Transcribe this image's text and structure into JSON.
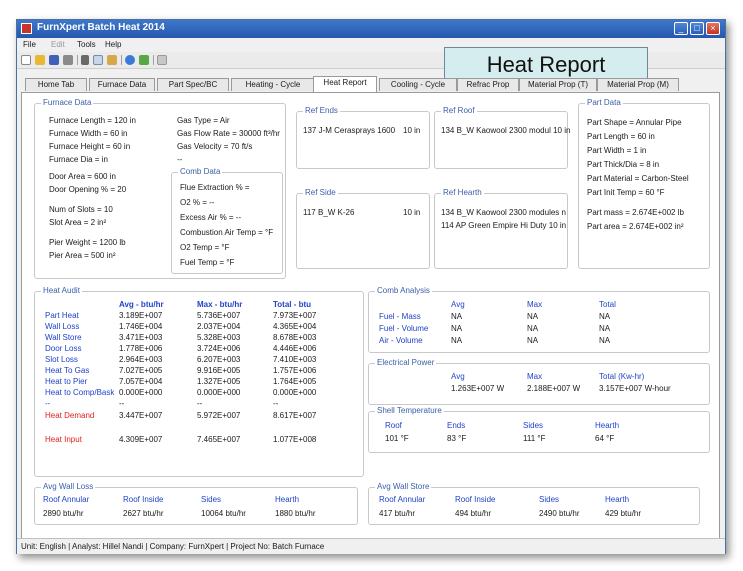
{
  "window": {
    "title": "FurnXpert Batch Heat 2014"
  },
  "menu": [
    "File",
    "Edit",
    "Tools",
    "Help"
  ],
  "callout": "Heat Report",
  "tabs": [
    "Home Tab",
    "Furnace Data",
    "Part Spec/BC",
    "Heating - Cycle",
    "Heat Report",
    "Cooling - Cycle",
    "Refrac Prop",
    "Material Prop (T)",
    "Material Prop (M)"
  ],
  "furnace_data": {
    "label": "Furnace Data",
    "col1": [
      "Furnace Length = 120 in",
      "Furnace Width = 60 in",
      "Furnace Height = 60 in",
      "Furnace Dia  =  in",
      "Door Area     = 600 in",
      "Door Opening % = 20",
      "Num of Slots   =  10",
      "Slot Area      =  2 in²",
      "Pier Weight    =  1200 lb",
      "Pier Area      =  500 in²"
    ],
    "col2": [
      "Gas Type      =  Air",
      "Gas Flow Rate  =  30000 ft³/hr",
      "Gas Velocity   =  70 ft/s",
      "--"
    ],
    "comb_label": "Comb Data",
    "comb": [
      "Flue Extraction % =",
      "O2 % =  --",
      "Excess Air % =  --",
      "Combustion Air Temp =   °F",
      "O2 Temp =  °F",
      "Fuel Temp =  °F"
    ]
  },
  "ref_ends": {
    "label": "Ref Ends",
    "name": "137 J-M Cerasprays 1600",
    "thick": "10 in"
  },
  "ref_roof": {
    "label": "Ref Roof",
    "name": "134 B_W Kaowool 2300 modul 10 in"
  },
  "ref_side": {
    "label": "Ref Side",
    "name": "117 B_W K-26",
    "thick": "10 in"
  },
  "ref_hearth": {
    "label": "Ref Hearth",
    "lines": [
      "134 B_W Kaowool 2300 modules n",
      "114 AP Green Empire Hi Duty  10 in"
    ]
  },
  "part_data": {
    "label": "Part Data",
    "lines": [
      "Part Shape = Annular Pipe",
      "Part Length = 60 in",
      "Part Width = 1 in",
      "Part Thick/Dia = 8 in",
      "Part Material = Carbon-Steel",
      "Part Init Temp = 60 °F",
      "Part mass = 2.674E+002 lb",
      "Part area = 2.674E+002 in²"
    ]
  },
  "heat_audit": {
    "label": "Heat Audit",
    "headers": [
      "Avg - btu/hr",
      "Max - btu/hr",
      "Total - btu"
    ],
    "rows": [
      {
        "name": "Part Heat",
        "avg": "3.189E+007",
        "max": "5.736E+007",
        "total": "7.973E+007"
      },
      {
        "name": "Wall Loss",
        "avg": "1.746E+004",
        "max": "2.037E+004",
        "total": "4.365E+004"
      },
      {
        "name": "Wall Store",
        "avg": "3.471E+003",
        "max": "5.328E+003",
        "total": "8.678E+003"
      },
      {
        "name": "Door Loss",
        "avg": "1.778E+006",
        "max": "3.724E+006",
        "total": "4.446E+006"
      },
      {
        "name": "Slot Loss",
        "avg": "2.964E+003",
        "max": "6.207E+003",
        "total": "7.410E+003"
      },
      {
        "name": "Heat To Gas",
        "avg": "7.027E+005",
        "max": "9.916E+005",
        "total": "1.757E+006"
      },
      {
        "name": "Heat to Pier",
        "avg": "7.057E+004",
        "max": "1.327E+005",
        "total": "1.764E+005"
      },
      {
        "name": "Heat to Comp/Bask",
        "avg": "0.000E+000",
        "max": "0.000E+000",
        "total": "0.000E+000"
      },
      {
        "name": "--",
        "avg": "--",
        "max": "--",
        "total": "--"
      }
    ],
    "demand": {
      "name": "Heat Demand",
      "avg": "3.447E+007",
      "max": "5.972E+007",
      "total": "8.617E+007"
    },
    "input": {
      "name": "Heat Input",
      "avg": "4.309E+007",
      "max": "7.465E+007",
      "total": "1.077E+008"
    }
  },
  "comb_analysis": {
    "label": "Comb Analysis",
    "headers": [
      "Avg",
      "Max",
      "Total"
    ],
    "rows": [
      {
        "name": "Fuel - Mass",
        "avg": "NA",
        "max": "NA",
        "total": "NA"
      },
      {
        "name": "Fuel - Volume",
        "avg": "NA",
        "max": "NA",
        "total": "NA"
      },
      {
        "name": "Air - Volume",
        "avg": "NA",
        "max": "NA",
        "total": "NA"
      }
    ]
  },
  "electrical": {
    "label": "Electrical Power",
    "headers": [
      "Avg",
      "Max",
      "Total (Kw-hr)"
    ],
    "values": [
      "1.263E+007 W",
      "2.188E+007 W",
      "3.157E+007 W-hour"
    ]
  },
  "shell_temp": {
    "label": "Shell Temperature",
    "headers": [
      "Roof",
      "Ends",
      "Sides",
      "Hearth"
    ],
    "values": [
      "101 °F",
      "83 °F",
      "111 °F",
      "64 °F"
    ]
  },
  "avg_wall_loss": {
    "label": "Avg Wall Loss",
    "headers": [
      "Roof Annular",
      "Roof Inside",
      "Sides",
      "Hearth"
    ],
    "values": [
      "2890 btu/hr",
      "2627 btu/hr",
      "10064 btu/hr",
      "1880 btu/hr"
    ]
  },
  "avg_wall_store": {
    "label": "Avg Wall Store",
    "headers": [
      "Roof Annular",
      "Roof Inside",
      "Sides",
      "Hearth"
    ],
    "values": [
      "417 btu/hr",
      "494 btu/hr",
      "2490 btu/hr",
      "429 btu/hr"
    ]
  },
  "status": "Unit: English  |  Analyst: Hillel Nandi  |  Company: FurnXpert  |  Project No: Batch Furnace"
}
